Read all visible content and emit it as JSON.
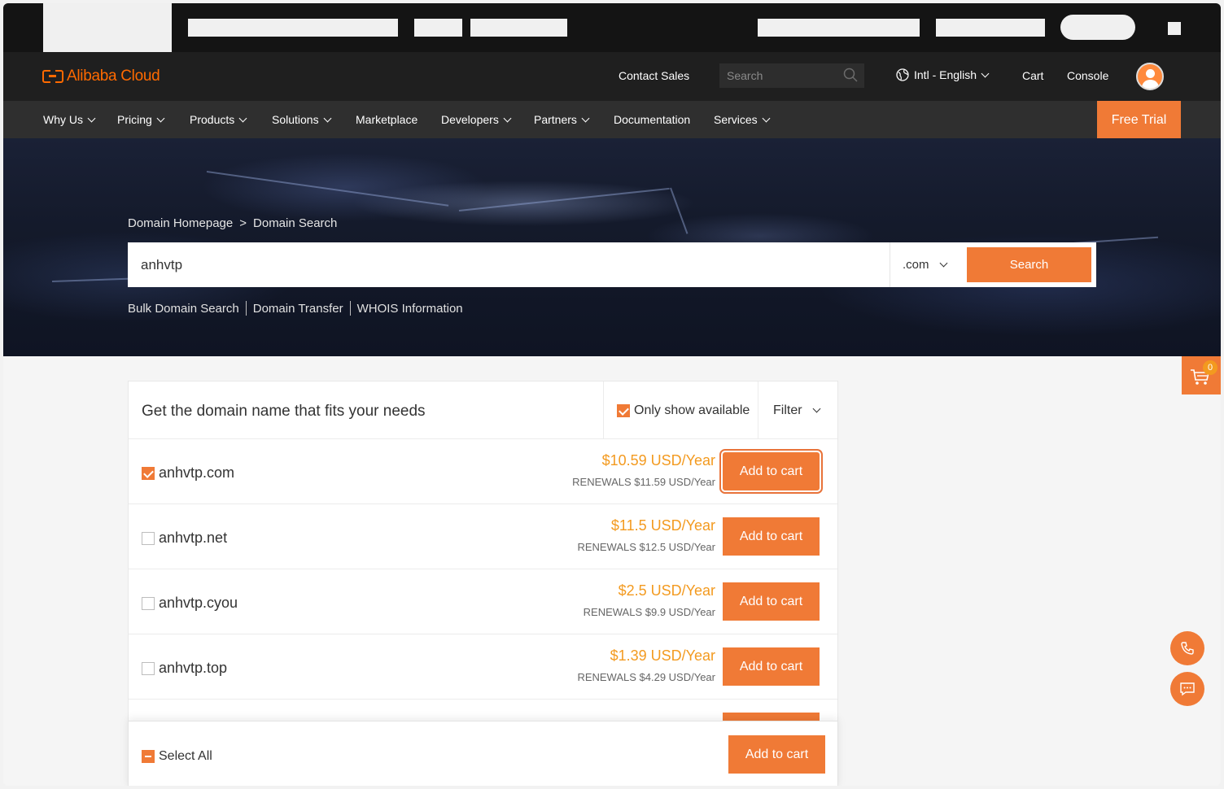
{
  "header": {
    "brand": "Alibaba Cloud",
    "contact_sales": "Contact Sales",
    "search_placeholder": "Search",
    "language": "Intl - English",
    "cart": "Cart",
    "console": "Console"
  },
  "nav": {
    "items": [
      {
        "label": "Why Us",
        "dropdown": true
      },
      {
        "label": "Pricing",
        "dropdown": true
      },
      {
        "label": "Products",
        "dropdown": true
      },
      {
        "label": "Solutions",
        "dropdown": true
      },
      {
        "label": "Marketplace",
        "dropdown": false
      },
      {
        "label": "Developers",
        "dropdown": true
      },
      {
        "label": "Partners",
        "dropdown": true
      },
      {
        "label": "Documentation",
        "dropdown": false
      },
      {
        "label": "Services",
        "dropdown": true
      }
    ],
    "free_trial": "Free Trial"
  },
  "breadcrumb": {
    "home": "Domain Homepage",
    "separator": ">",
    "current": "Domain Search"
  },
  "domain_search": {
    "query": "anhvtp",
    "tld": ".com",
    "button": "Search"
  },
  "sublinks": [
    "Bulk Domain Search",
    "Domain Transfer",
    "WHOIS Information"
  ],
  "floating_cart": {
    "count": "0"
  },
  "results": {
    "title": "Get the domain name that fits your needs",
    "only_available_label": "Only show available",
    "only_available_checked": true,
    "filter_label": "Filter",
    "add_label": "Add to cart",
    "rows": [
      {
        "domain": "anhvtp.com",
        "checked": true,
        "price": "$10.59 USD/Year",
        "renewal": "RENEWALS $11.59 USD/Year"
      },
      {
        "domain": "anhvtp.net",
        "checked": false,
        "price": "$11.5 USD/Year",
        "renewal": "RENEWALS $12.5 USD/Year"
      },
      {
        "domain": "anhvtp.cyou",
        "checked": false,
        "price": "$2.5 USD/Year",
        "renewal": "RENEWALS $9.9 USD/Year"
      },
      {
        "domain": "anhvtp.top",
        "checked": false,
        "price": "$1.39 USD/Year",
        "renewal": "RENEWALS $4.29 USD/Year"
      }
    ]
  },
  "footer_bar": {
    "select_all": "Select All",
    "add_to_cart": "Add to cart"
  },
  "colors": {
    "accent": "#f07a36",
    "price": "#f39a1f",
    "header_bg": "#1f1f1f",
    "nav_bg": "#2f2f2f"
  }
}
